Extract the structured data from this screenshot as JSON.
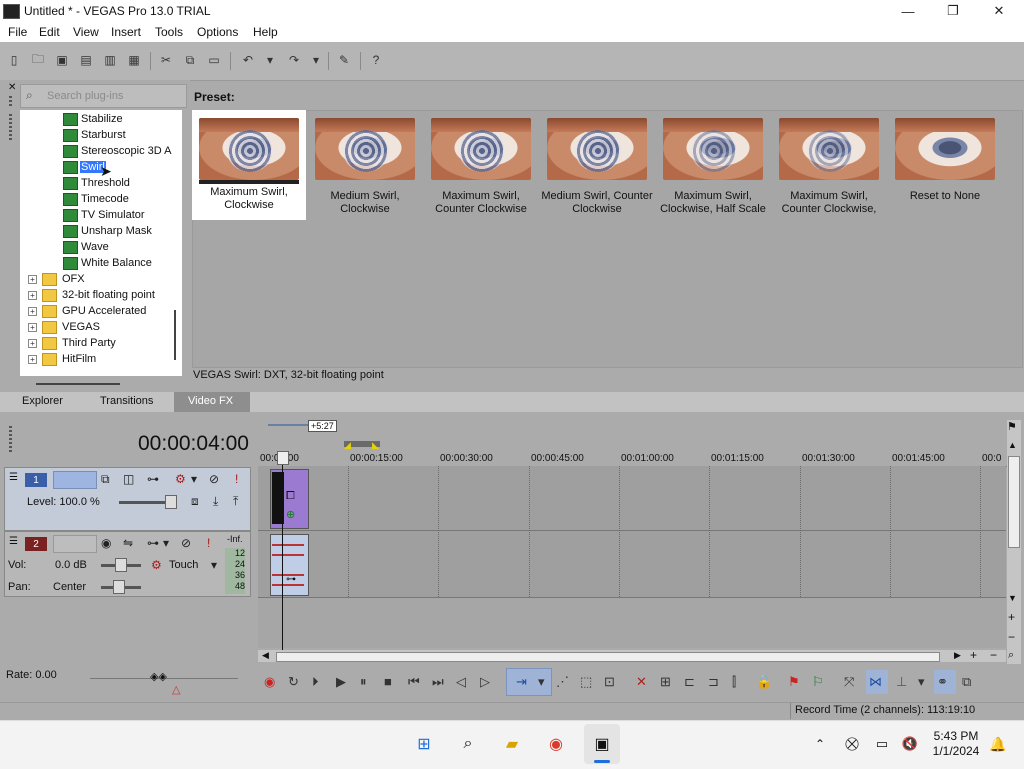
{
  "window": {
    "title": "Untitled * - VEGAS Pro 13.0 TRIAL",
    "minimize": "—",
    "maximize": "❐",
    "close": "✕"
  },
  "menu": [
    "File",
    "Edit",
    "View",
    "Insert",
    "Tools",
    "Options",
    "Help"
  ],
  "search": {
    "placeholder": "Search plug-ins"
  },
  "tree": {
    "fx_items": [
      "Stabilize",
      "Starburst",
      "Stereoscopic 3D A",
      "Swirl",
      "Threshold",
      "Timecode",
      "TV Simulator",
      "Unsharp Mask",
      "Wave",
      "White Balance"
    ],
    "selected": "Swirl",
    "folders": [
      "OFX",
      "32-bit floating point",
      "GPU Accelerated",
      "VEGAS",
      "Third Party",
      "HitFilm"
    ]
  },
  "preset": {
    "label": "Preset:",
    "items": [
      {
        "line1": "Maximum Swirl,",
        "line2": "Clockwise"
      },
      {
        "line1": "Medium Swirl,",
        "line2": "Clockwise"
      },
      {
        "line1": "Maximum Swirl,",
        "line2": "Counter Clockwise"
      },
      {
        "line1": "Medium Swirl, Counter",
        "line2": "Clockwise"
      },
      {
        "line1": "Maximum Swirl,",
        "line2": "Clockwise, Half Scale"
      },
      {
        "line1": "Maximum Swirl,",
        "line2": "Counter Clockwise,"
      },
      {
        "line1": "Reset to None",
        "line2": ""
      }
    ],
    "description": "VEGAS Swirl: DXT, 32-bit floating point"
  },
  "tabs": [
    "Explorer",
    "Transitions",
    "Video FX"
  ],
  "timeline": {
    "timecode": "00:00:04:00",
    "length_badge": "+5:27",
    "ruler": [
      "00:00:00",
      "00:00:15:00",
      "00:00:30:00",
      "00:00:45:00",
      "00:01:00:00",
      "00:01:15:00",
      "00:01:30:00",
      "00:01:45:00",
      "00:0"
    ],
    "video_track": {
      "number": "1",
      "level": "Level: 100.0 %"
    },
    "audio_track": {
      "number": "2",
      "vol_label": "Vol:",
      "vol_value": "0.0 dB",
      "pan_label": "Pan:",
      "pan_value": "Center",
      "mode": "Touch",
      "meter_top": "-Inf.",
      "meter_vals": [
        "12",
        "24",
        "36",
        "48"
      ]
    },
    "rate": "Rate: 0.00"
  },
  "status": {
    "record_time": "Record Time (2 channels): 113:19:10"
  },
  "taskbar": {
    "time": "5:43 PM",
    "date": "1/1/2024"
  },
  "colors": {
    "selection": "#3377ff",
    "video_track": "#c3cbd9",
    "video_clip": "#9b7ad1",
    "audio_clip": "#bfcde6"
  }
}
